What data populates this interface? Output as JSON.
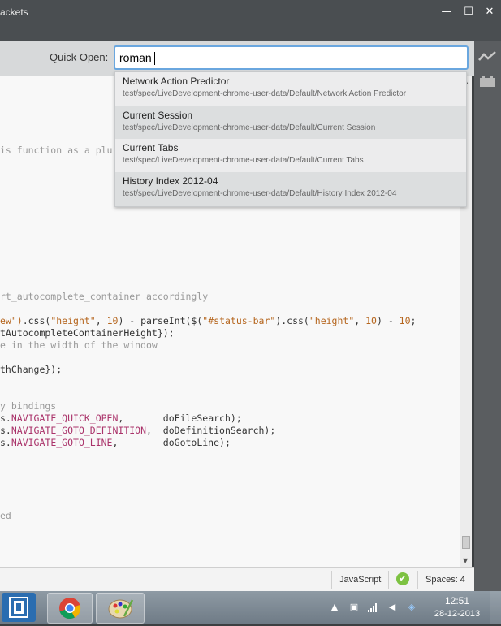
{
  "window": {
    "title": "ackets",
    "minimize": "—",
    "maximize": "☐",
    "close": "✕"
  },
  "quick_open": {
    "label": "Quick Open:",
    "value": "roman"
  },
  "results": [
    {
      "name": "Network Action Predictor",
      "path": "test/spec/LiveDevelopment-chrome-user-data/Default/Network Action Predictor"
    },
    {
      "name": "Current Session",
      "path": "test/spec/LiveDevelopment-chrome-user-data/Default/Current Session"
    },
    {
      "name": "Current Tabs",
      "path": "test/spec/LiveDevelopment-chrome-user-data/Default/Current Tabs"
    },
    {
      "name": "History Index 2012-04",
      "path": "test/spec/LiveDevelopment-chrome-user-data/Default/History Index 2012-04"
    }
  ],
  "code": {
    "l1": "is function as a plu",
    "l2": "rt_autocomplete_container accordingly",
    "l3a": "ew\")",
    "l3b": ".css(",
    "l3c": "\"height\"",
    "l3d": ", ",
    "l3e": "10",
    "l3f": ") - parseInt($(",
    "l3g": "\"#status-bar\"",
    "l3h": ").css(",
    "l3i": "\"height\"",
    "l3j": ", ",
    "l3k": "10",
    "l3l": ") - ",
    "l3m": "10",
    "l3n": ";",
    "l4": "tAutocompleteContainerHeight});",
    "l5": "e in the width of the window",
    "l6": "thChange});",
    "l7": "y bindings",
    "l8a": "s.",
    "l8b": "NAVIGATE_QUICK_OPEN",
    "l8c": ",       doFileSearch);",
    "l9a": "s.",
    "l9b": "NAVIGATE_GOTO_DEFINITION",
    "l9c": ",  doDefinitionSearch);",
    "l10a": "s.",
    "l10b": "NAVIGATE_GOTO_LINE",
    "l10c": ",        doGotoLine);",
    "l11": "ed"
  },
  "status": {
    "language": "JavaScript",
    "check": "✔",
    "spaces": "Spaces:  4"
  },
  "taskbar": {
    "time": "12:51",
    "date": "28-12-2013"
  }
}
